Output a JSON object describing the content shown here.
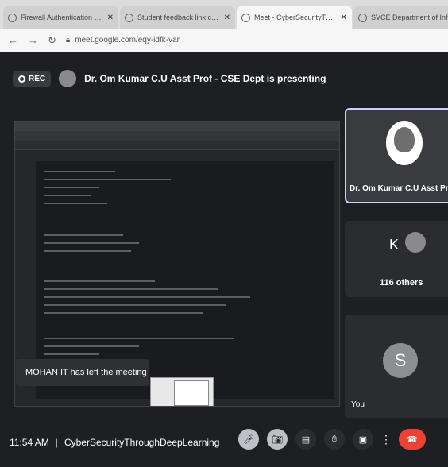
{
  "browser": {
    "tabs": [
      {
        "title": "Firewall Authentication Keepaliv",
        "active": false
      },
      {
        "title": "Student feedback link cybersecu",
        "active": false
      },
      {
        "title": "Meet - CyberSecurityThrou",
        "active": true
      },
      {
        "title": "SVCE Department of Informati",
        "active": false
      }
    ],
    "url": "meet.google.com/eqy-idfk-var"
  },
  "meet": {
    "rec_label": "REC",
    "presenting_text": "Dr. Om Kumar C.U Asst Prof - CSE Dept is presenting",
    "toast_text": "MOHAN IT has left the meeting",
    "tiles": {
      "main_name": "Dr. Om Kumar C.U Asst Prof - C",
      "others_initial": "K",
      "others_label": "116 others",
      "self_initial": "S",
      "self_label": "You"
    },
    "time": "11:54 AM",
    "separator": "|",
    "meeting_name": "CyberSecurityThroughDeepLearning",
    "icons": [
      "mic-icon",
      "camera-icon",
      "captions-icon",
      "raise-hand-icon",
      "present-icon",
      "more-icon",
      "leave-call-icon"
    ]
  }
}
